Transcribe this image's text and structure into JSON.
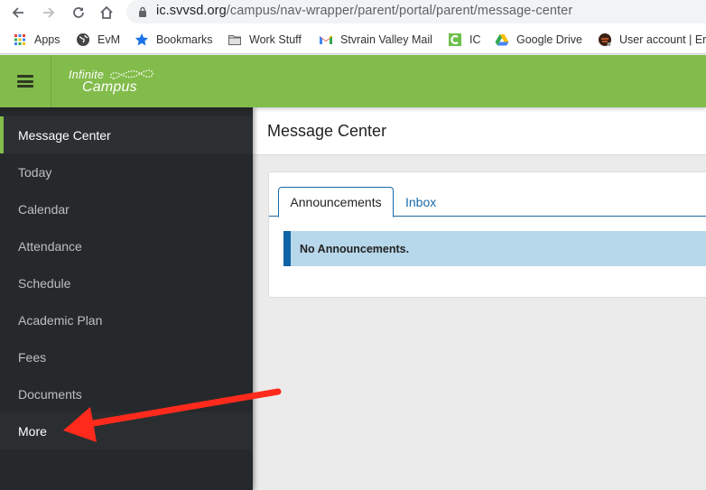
{
  "browser": {
    "url_host": "ic.svvsd.org",
    "url_path": "/campus/nav-wrapper/parent/portal/parent/message-center",
    "bookmarks": [
      {
        "label": "Apps",
        "icon": "apps-grid-icon"
      },
      {
        "label": "EvM",
        "icon": "globe-icon"
      },
      {
        "label": "Bookmarks",
        "icon": "star-icon"
      },
      {
        "label": "Work Stuff",
        "icon": "folder-icon"
      },
      {
        "label": "Stvrain Valley Mail",
        "icon": "gmail-icon"
      },
      {
        "label": "IC",
        "icon": "infinite-campus-icon"
      },
      {
        "label": "Google Drive",
        "icon": "google-drive-icon"
      },
      {
        "label": "User account | Er",
        "icon": "user-account-favicon"
      }
    ]
  },
  "app": {
    "logo_line1": "Infinite",
    "logo_line2": "Campus",
    "brand_color": "#82bc4b"
  },
  "sidebar": {
    "items": [
      {
        "label": "Message Center",
        "active": true
      },
      {
        "label": "Today"
      },
      {
        "label": "Calendar"
      },
      {
        "label": "Attendance"
      },
      {
        "label": "Schedule"
      },
      {
        "label": "Academic Plan"
      },
      {
        "label": "Fees"
      },
      {
        "label": "Documents"
      },
      {
        "label": "More",
        "highlighted": true
      }
    ]
  },
  "main": {
    "title": "Message Center",
    "tabs": [
      {
        "label": "Announcements",
        "active": true
      },
      {
        "label": "Inbox"
      }
    ],
    "alert_text": "No Announcements."
  },
  "annotation": {
    "type": "arrow",
    "color": "#ff2a1c",
    "points_to": "More"
  }
}
